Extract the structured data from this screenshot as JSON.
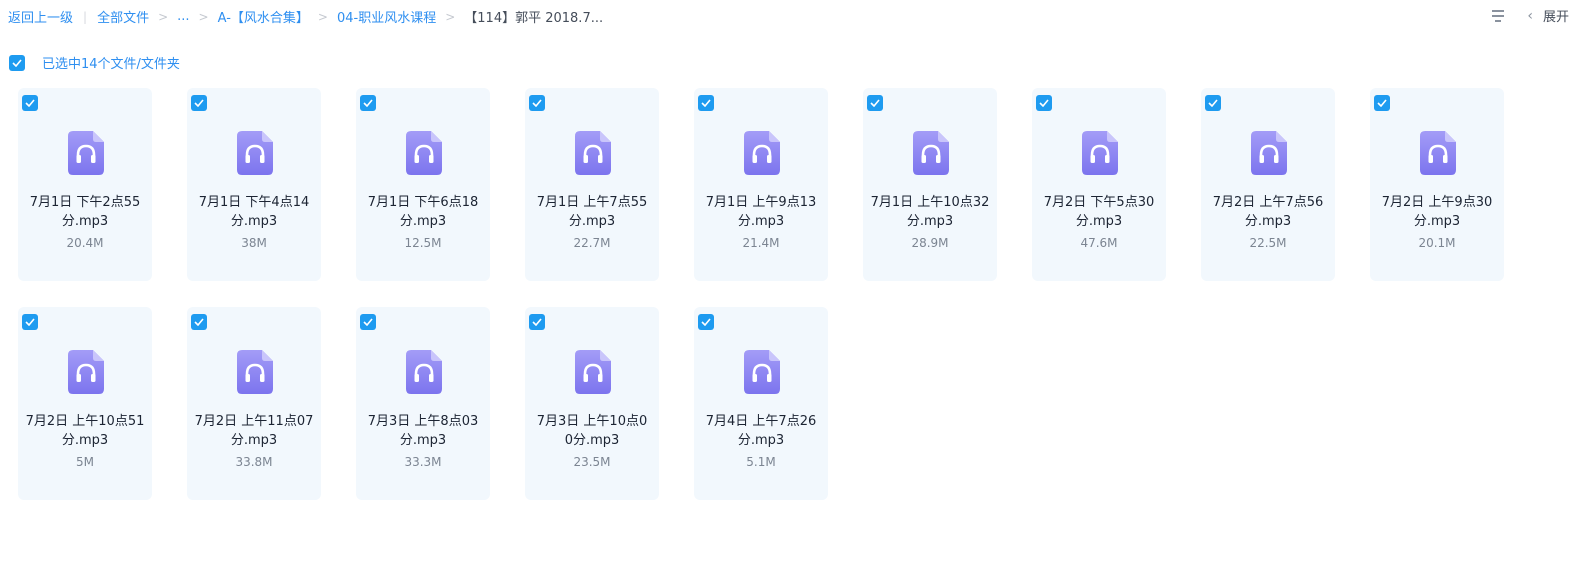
{
  "breadcrumb": {
    "back": "返回上一级",
    "all_files": "全部文件",
    "ellipsis": "...",
    "folder1": "A-【风水合集】",
    "folder2": "04-职业风水课程",
    "current": "【114】郭平 2018.7..."
  },
  "toolbar": {
    "list_icon": "list-view-icon",
    "collapse_icon": "chevron-left-icon",
    "expand_label": "展开"
  },
  "selection": {
    "label": "已选中14个文件/文件夹",
    "checked": true
  },
  "file_icon": "audio-file-icon",
  "colors": {
    "accent": "#1e9bf0",
    "card_bg": "#f2f8fd",
    "icon_purple": "#8b86f2"
  },
  "files": [
    {
      "name_line1": "7月1日 下午2点55",
      "name_line2": "分.mp3",
      "size": "20.4M",
      "checked": true
    },
    {
      "name_line1": "7月1日 下午4点14",
      "name_line2": "分.mp3",
      "size": "38M",
      "checked": true
    },
    {
      "name_line1": "7月1日 下午6点18",
      "name_line2": "分.mp3",
      "size": "12.5M",
      "checked": true
    },
    {
      "name_line1": "7月1日 上午7点55",
      "name_line2": "分.mp3",
      "size": "22.7M",
      "checked": true
    },
    {
      "name_line1": "7月1日 上午9点13",
      "name_line2": "分.mp3",
      "size": "21.4M",
      "checked": true
    },
    {
      "name_line1": "7月1日 上午10点32",
      "name_line2": "分.mp3",
      "size": "28.9M",
      "checked": true
    },
    {
      "name_line1": "7月2日 下午5点30",
      "name_line2": "分.mp3",
      "size": "47.6M",
      "checked": true
    },
    {
      "name_line1": "7月2日 上午7点56",
      "name_line2": "分.mp3",
      "size": "22.5M",
      "checked": true
    },
    {
      "name_line1": "7月2日 上午9点30",
      "name_line2": "分.mp3",
      "size": "20.1M",
      "checked": true
    },
    {
      "name_line1": "7月2日 上午10点51",
      "name_line2": "分.mp3",
      "size": "5M",
      "checked": true
    },
    {
      "name_line1": "7月2日 上午11点07",
      "name_line2": "分.mp3",
      "size": "33.8M",
      "checked": true
    },
    {
      "name_line1": "7月3日 上午8点03",
      "name_line2": "分.mp3",
      "size": "33.3M",
      "checked": true
    },
    {
      "name_line1": "7月3日 上午10点0",
      "name_line2": "0分.mp3",
      "size": "23.5M",
      "checked": true
    },
    {
      "name_line1": "7月4日 上午7点26",
      "name_line2": "分.mp3",
      "size": "5.1M",
      "checked": true
    }
  ]
}
